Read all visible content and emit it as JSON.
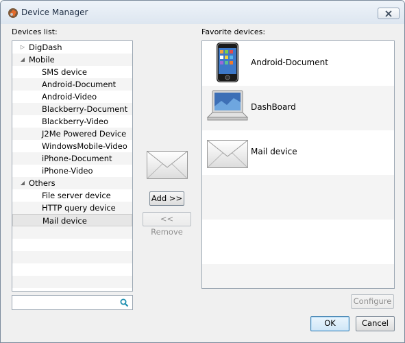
{
  "window": {
    "title": "Device Manager"
  },
  "devices_list": {
    "label": "Devices list:",
    "items": [
      {
        "label": "DigDash",
        "level": 0,
        "twisty": "collapsed"
      },
      {
        "label": "Mobile",
        "level": 0,
        "twisty": "expanded"
      },
      {
        "label": "SMS device",
        "level": 1
      },
      {
        "label": "Android-Document",
        "level": 1
      },
      {
        "label": "Android-Video",
        "level": 1
      },
      {
        "label": "Blackberry-Document",
        "level": 1
      },
      {
        "label": "Blackberry-Video",
        "level": 1
      },
      {
        "label": "J2Me Powered Device",
        "level": 1
      },
      {
        "label": "WindowsMobile-Video",
        "level": 1
      },
      {
        "label": "iPhone-Document",
        "level": 1
      },
      {
        "label": "iPhone-Video",
        "level": 1
      },
      {
        "label": "Others",
        "level": 0,
        "twisty": "expanded"
      },
      {
        "label": "File server device",
        "level": 1
      },
      {
        "label": "HTTP query device",
        "level": 1
      },
      {
        "label": "Mail device",
        "level": 1,
        "selected": true
      }
    ]
  },
  "search": {
    "value": "",
    "placeholder": "",
    "icon": "search-icon"
  },
  "buttons": {
    "add": "Add >>",
    "remove": "<< Remove",
    "configure": "Configure",
    "ok": "OK",
    "cancel": "Cancel"
  },
  "favorites": {
    "label": "Favorite devices:",
    "items": [
      {
        "label": "Android-Document",
        "icon": "smartphone-icon"
      },
      {
        "label": "DashBoard",
        "icon": "laptop-icon"
      },
      {
        "label": "Mail device",
        "icon": "mail-icon"
      }
    ]
  },
  "colors": {
    "accent": "#3c7fb1",
    "titlebar": "#dde6f0"
  }
}
